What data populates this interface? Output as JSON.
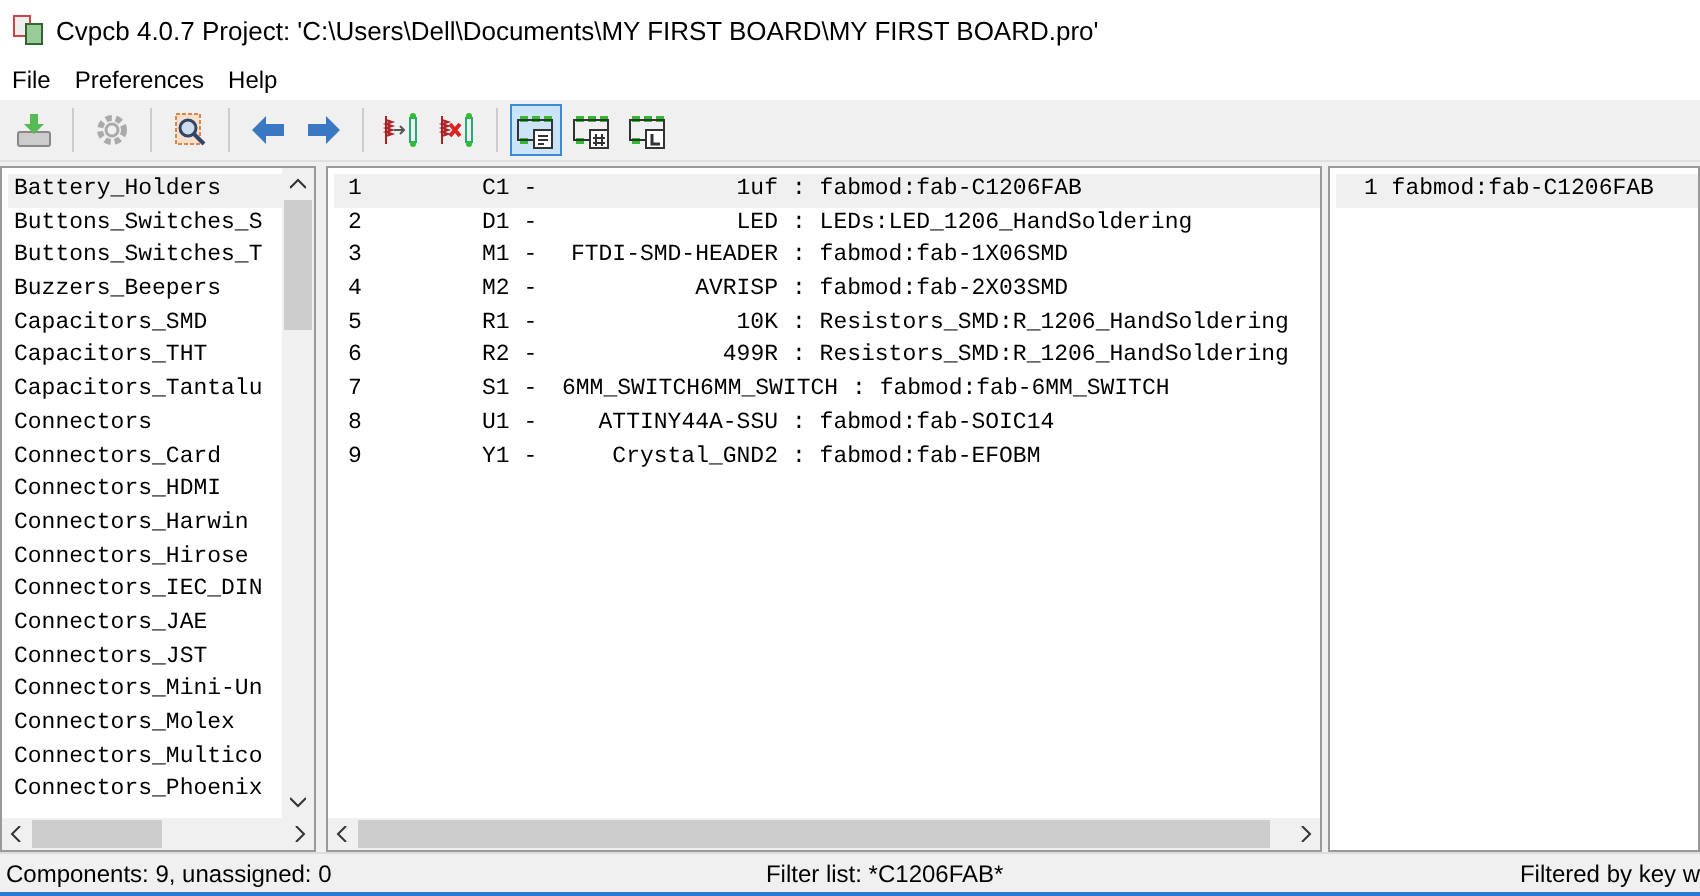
{
  "window": {
    "title": "Cvpcb 4.0.7  Project: 'C:\\Users\\Dell\\Documents\\MY FIRST BOARD\\MY FIRST BOARD.pro'"
  },
  "menu": [
    "File",
    "Preferences",
    "Help"
  ],
  "toolbar": [
    [
      {
        "kind": "save",
        "selected": false
      }
    ],
    [
      {
        "kind": "gear",
        "selected": false
      }
    ],
    [
      {
        "kind": "inspect",
        "selected": false
      }
    ],
    [
      {
        "kind": "left",
        "selected": false
      },
      {
        "kind": "right",
        "selected": false
      }
    ],
    [
      {
        "kind": "assign",
        "selected": false
      },
      {
        "kind": "unassign",
        "selected": false
      }
    ],
    [
      {
        "kind": "list",
        "selected": true
      },
      {
        "kind": "hash",
        "selected": false
      },
      {
        "kind": "letter",
        "selected": false
      }
    ]
  ],
  "libraries": [
    {
      "name": "Battery_Holders",
      "selected": true
    },
    {
      "name": "Buttons_Switches_S",
      "selected": false
    },
    {
      "name": "Buttons_Switches_T",
      "selected": false
    },
    {
      "name": "Buzzers_Beepers",
      "selected": false
    },
    {
      "name": "Capacitors_SMD",
      "selected": false
    },
    {
      "name": "Capacitors_THT",
      "selected": false
    },
    {
      "name": "Capacitors_Tantalu",
      "selected": false
    },
    {
      "name": "Connectors",
      "selected": false
    },
    {
      "name": "Connectors_Card",
      "selected": false
    },
    {
      "name": "Connectors_HDMI",
      "selected": false
    },
    {
      "name": "Connectors_Harwin",
      "selected": false
    },
    {
      "name": "Connectors_Hirose",
      "selected": false
    },
    {
      "name": "Connectors_IEC_DIN",
      "selected": false
    },
    {
      "name": "Connectors_JAE",
      "selected": false
    },
    {
      "name": "Connectors_JST",
      "selected": false
    },
    {
      "name": "Connectors_Mini-Un",
      "selected": false
    },
    {
      "name": "Connectors_Molex",
      "selected": false
    },
    {
      "name": "Connectors_Multico",
      "selected": false
    },
    {
      "name": "Connectors_Phoenix",
      "selected": false
    }
  ],
  "components": [
    {
      "number": "1",
      "ref": "C1 -",
      "value": "1uf",
      "footprint": ": fabmod:fab-C1206FAB",
      "selected": true
    },
    {
      "number": "2",
      "ref": "D1 -",
      "value": "LED",
      "footprint": ": LEDs:LED_1206_HandSoldering",
      "selected": false
    },
    {
      "number": "3",
      "ref": "M1 -",
      "value": "FTDI-SMD-HEADER",
      "footprint": ": fabmod:fab-1X06SMD",
      "selected": false
    },
    {
      "number": "4",
      "ref": "M2 -",
      "value": "AVRISP",
      "footprint": ": fabmod:fab-2X03SMD",
      "selected": false
    },
    {
      "number": "5",
      "ref": "R1 -",
      "value": "10K",
      "footprint": ": Resistors_SMD:R_1206_HandSoldering",
      "selected": false
    },
    {
      "number": "6",
      "ref": "R2 -",
      "value": "499R",
      "footprint": ": Resistors_SMD:R_1206_HandSoldering",
      "selected": false
    },
    {
      "number": "7",
      "ref": "S1 -",
      "value": "6MM_SWITCH6MM_SWITCH",
      "footprint": ": fabmod:fab-6MM_SWITCH",
      "selected": false
    },
    {
      "number": "8",
      "ref": "U1 -",
      "value": "ATTINY44A-SSU",
      "footprint": ": fabmod:fab-SOIC14",
      "selected": false
    },
    {
      "number": "9",
      "ref": "Y1 -",
      "value": "Crystal_GND2",
      "footprint": ": fabmod:fab-EFOBM",
      "selected": false
    }
  ],
  "footprints": [
    {
      "text": "1 fabmod:fab-C1206FAB",
      "selected": true
    }
  ],
  "status_bar": [
    "Components: 9, unassigned: 0",
    "Filter list: *C1206FAB*",
    "Filtered by key w"
  ]
}
